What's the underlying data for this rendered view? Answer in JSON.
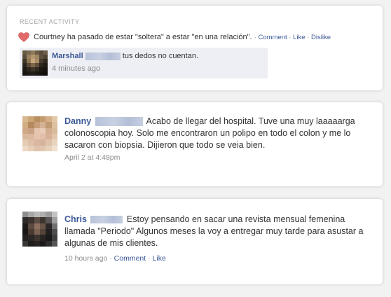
{
  "colors": {
    "link": "#3b5998",
    "muted": "#8b8b8b",
    "reply_bg": "#edeff4",
    "heart": "#e06a6a"
  },
  "recent_activity": {
    "header": "RECENT ACTIVITY",
    "text": "Courtney ha pasado de estar \"soltera\" a estar \"en una relación\".",
    "actions": {
      "comment": "Comment",
      "like": "Like",
      "dislike": "Dislike"
    },
    "reply": {
      "name": "Marshall",
      "text": "tus dedos no cuentan.",
      "time": "4 minutes ago"
    }
  },
  "posts": [
    {
      "name": "Danny",
      "text": "Acabo de llegar del hospital. Tuve una muy laaaaarga colonoscopia hoy. Solo me encontraron un polipo en todo el colon y me lo sacaron con biopsia. Dijieron que todo se veia bien.",
      "time": "April 2 at 4:48pm"
    },
    {
      "name": "Chris",
      "text": "Estoy pensando en sacar una revista mensual femenina llamada \"Periodo\" Algunos meses la voy a entregar muy tarde para asustar a algunas de mis clientes.",
      "time": "10 hours ago",
      "actions": {
        "comment": "Comment",
        "like": "Like"
      }
    }
  ],
  "separators": {
    "dot": "·"
  }
}
